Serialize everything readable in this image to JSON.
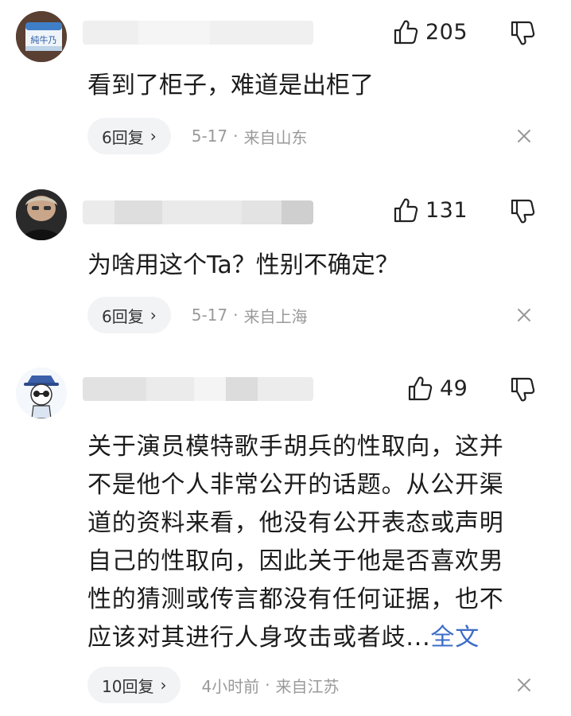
{
  "comments": [
    {
      "likes": "205",
      "text": "看到了柜子，难道是出柜了",
      "replies": "6回复",
      "time": "5-17",
      "location": "来自山东"
    },
    {
      "likes": "131",
      "text": "为啥用这个Ta？性别不确定？",
      "replies": "6回复",
      "time": "5-17",
      "location": "来自上海"
    },
    {
      "likes": "49",
      "text_lines": [
        "关于演员模特歌手胡兵的性取向，这并",
        "不是他个人非常公开的话题。从公开渠",
        "道的资料来看，他没有公开表态或声明",
        "自己的性取向，因此关于他是否喜欢男",
        "性的猜测或传言都没有任何证据，也不",
        "应该对其进行人身攻击或者歧..."
      ],
      "more": "全文",
      "replies": "10回复",
      "time": "4小时前",
      "location": "来自江苏"
    }
  ],
  "reply_chevron": "›",
  "separator": "·",
  "avatar_text_1": "純牛乃",
  "colors": {
    "link": "#3c6cc8",
    "meta_gray": "#9a9a9a",
    "pill_bg": "#f2f3f5"
  },
  "icons": [
    "thumbs-up-icon",
    "thumbs-down-icon",
    "close-icon",
    "chevron-right-icon"
  ]
}
